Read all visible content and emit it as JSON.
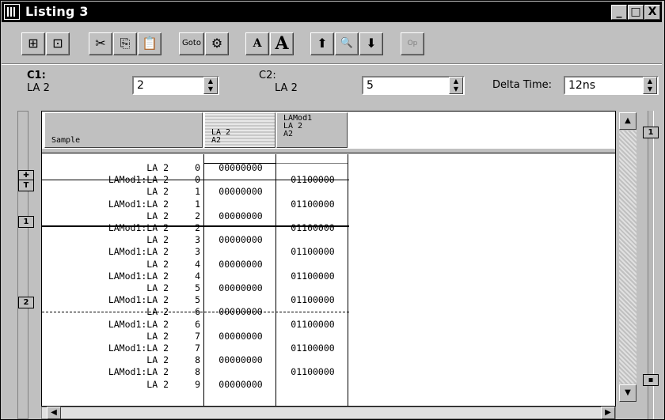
{
  "window": {
    "title": "Listing 3",
    "min_label": "_",
    "max_label": "□",
    "close_label": "X"
  },
  "toolbar": {
    "buttons": [
      {
        "name": "insert-column-icon",
        "glyph": "⊞"
      },
      {
        "name": "add-label-icon",
        "glyph": "⊡"
      },
      {
        "name": "cut-icon",
        "glyph": "✂"
      },
      {
        "name": "copy-icon",
        "glyph": "⎘"
      },
      {
        "name": "paste-icon",
        "glyph": "📋"
      },
      {
        "name": "goto-icon",
        "glyph": "Goto"
      },
      {
        "name": "properties-icon",
        "glyph": "⚙"
      },
      {
        "name": "font-small-icon",
        "glyph": "A"
      },
      {
        "name": "font-large-icon",
        "glyph": "A"
      },
      {
        "name": "arrow-up-icon",
        "glyph": "⬆"
      },
      {
        "name": "find-icon",
        "glyph": "🔍"
      },
      {
        "name": "arrow-down-icon",
        "glyph": "⬇"
      },
      {
        "name": "opcode-icon",
        "glyph": "Op"
      }
    ]
  },
  "cursors": {
    "c1_label": "C1:",
    "c1_sub": "LA 2",
    "c1_value": "2",
    "c2_label": "C2:",
    "c2_sub": "LA 2",
    "c2_value": "5",
    "delta_label": "Delta Time:",
    "delta_value": "12ns"
  },
  "columns": {
    "sample": "Sample",
    "col1": [
      "LA 2",
      "A2"
    ],
    "col2": [
      "LAMod1",
      "LA 2",
      "A2"
    ]
  },
  "rows": [
    {
      "label": "LA 2",
      "n": "0",
      "a": "00000000",
      "b": ""
    },
    {
      "label": "LAMod1:LA 2",
      "n": "0",
      "a": "",
      "b": "01100000"
    },
    {
      "label": "LA 2",
      "n": "1",
      "a": "00000000",
      "b": ""
    },
    {
      "label": "LAMod1:LA 2",
      "n": "1",
      "a": "",
      "b": "01100000"
    },
    {
      "label": "LA 2",
      "n": "2",
      "a": "00000000",
      "b": ""
    },
    {
      "label": "LAMod1:LA 2",
      "n": "2",
      "a": "",
      "b": "01100000"
    },
    {
      "label": "LA 2",
      "n": "3",
      "a": "00000000",
      "b": ""
    },
    {
      "label": "LAMod1:LA 2",
      "n": "3",
      "a": "",
      "b": "01100000"
    },
    {
      "label": "LA 2",
      "n": "4",
      "a": "00000000",
      "b": ""
    },
    {
      "label": "LAMod1:LA 2",
      "n": "4",
      "a": "",
      "b": "01100000"
    },
    {
      "label": "LA 2",
      "n": "5",
      "a": "00000000",
      "b": ""
    },
    {
      "label": "LAMod1:LA 2",
      "n": "5",
      "a": "",
      "b": "01100000"
    },
    {
      "label": "LA 2",
      "n": "6",
      "a": "00000000",
      "b": ""
    },
    {
      "label": "LAMod1:LA 2",
      "n": "6",
      "a": "",
      "b": "01100000"
    },
    {
      "label": "LA 2",
      "n": "7",
      "a": "00000000",
      "b": ""
    },
    {
      "label": "LAMod1:LA 2",
      "n": "7",
      "a": "",
      "b": "01100000"
    },
    {
      "label": "LA 2",
      "n": "8",
      "a": "00000000",
      "b": ""
    },
    {
      "label": "LAMod1:LA 2",
      "n": "8",
      "a": "",
      "b": "01100000"
    },
    {
      "label": "LA 2",
      "n": "9",
      "a": "00000000",
      "b": ""
    }
  ],
  "markers": {
    "trigger": "T",
    "c1": "1",
    "c2": "2",
    "right_c1": "1"
  }
}
